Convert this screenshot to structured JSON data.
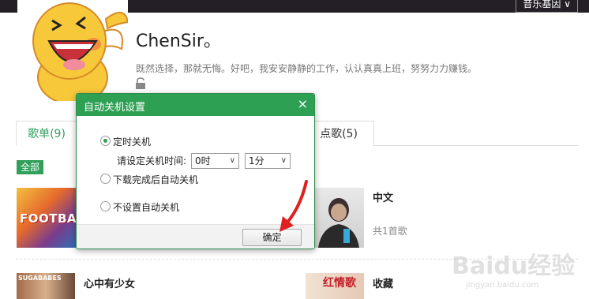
{
  "topbar": {
    "button_label": "音乐基因"
  },
  "profile": {
    "username": "ChenSir。",
    "bio": "既然选择，那就无悔。好吧，我安安静静的工作，认认真真上班，努努力力赚钱。"
  },
  "tabs": [
    {
      "label": "歌单(9)"
    },
    {
      "label": "点歌(5)"
    }
  ],
  "filter": {
    "label": "全部"
  },
  "playlists": [
    {
      "title": "中文",
      "subtitle": "共1首歌"
    },
    {
      "title": "心中有少女"
    },
    {
      "title": "收藏"
    }
  ],
  "covers": {
    "football_text": "FOOTBALL",
    "sugababes_text": "SUGABABES",
    "red_text": "红情歌"
  },
  "dialog": {
    "title": "自动关机设置",
    "close": "×",
    "options": [
      {
        "label": "定时关机",
        "checked": true
      },
      {
        "label": "下载完成后自动关机",
        "checked": false
      },
      {
        "label": "不设置自动关机",
        "checked": false
      }
    ],
    "time_label": "请设定关机时间:",
    "hour_value": "0时",
    "minute_value": "1分",
    "ok_label": "确定"
  },
  "watermark": {
    "brand": "Baidu经验",
    "url": "jingyan.baidu.com"
  },
  "colors": {
    "accent": "#2ea054",
    "topbar": "#241f26",
    "arrow": "#e02020"
  }
}
